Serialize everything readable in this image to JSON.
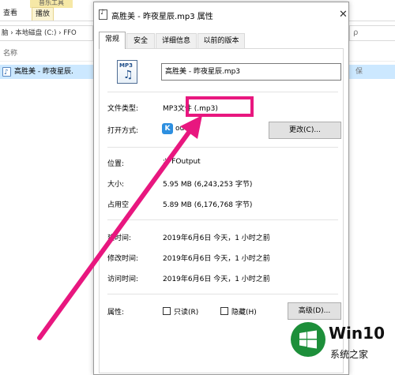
{
  "explorer": {
    "ribbon_music_tab": "音乐工具",
    "tab_view": "查看",
    "tab_play": "播放",
    "address_path": "脑 › 本地磁盘 (C:) › FFO",
    "address_search_glyph": "ρ",
    "column_name": "名称",
    "file_name": "高胜美 - 昨夜星辰.",
    "file_extra": "保"
  },
  "dialog": {
    "title": "高胜美 - 昨夜星辰.mp3 属性",
    "close_glyph": "✕",
    "tabs": [
      "常规",
      "安全",
      "详细信息",
      "以前的版本"
    ],
    "icon_tag": "MP3",
    "file_name": "高胜美 - 昨夜星辰.mp3",
    "file_type_label": "文件类型:",
    "file_type_value": "MP3文件 (.mp3)",
    "open_with_label": "打开方式:",
    "open_with_value": "酷狗音乐",
    "open_with_visible": "ou",
    "change_button": "更改(C)...",
    "location_label": "位置:",
    "location_value": "C:\\FFOutput",
    "location_visible": ":\\FFOutput",
    "size_label": "大小:",
    "size_value": "5.95 MB (6,243,253 字节)",
    "disk_size_label": "占用空间:",
    "disk_size_visible": "占用空",
    "disk_size_value": "5.89 MB (6,176,768 字节)",
    "created_label": "创建时间:",
    "created_visible": "建时间:",
    "created_value": "2019年6月6日  今天，1 小时之前",
    "modified_label": "修改时间:",
    "modified_value": "2019年6月6日  今天，1 小时之前",
    "accessed_label": "访问时间:",
    "accessed_value": "2019年6月6日  今天，1 小时之前",
    "attributes_label": "属性:",
    "readonly_label": "只读(R)",
    "hidden_label": "隐藏(H)",
    "advanced_button": "高级(D)..."
  },
  "annotation": {
    "highlight_color": "#e8177f",
    "arrow_color": "#e8177f"
  },
  "watermark": {
    "brand": "Win10",
    "subtitle": "系统之家",
    "color": "#1d8f3a"
  }
}
